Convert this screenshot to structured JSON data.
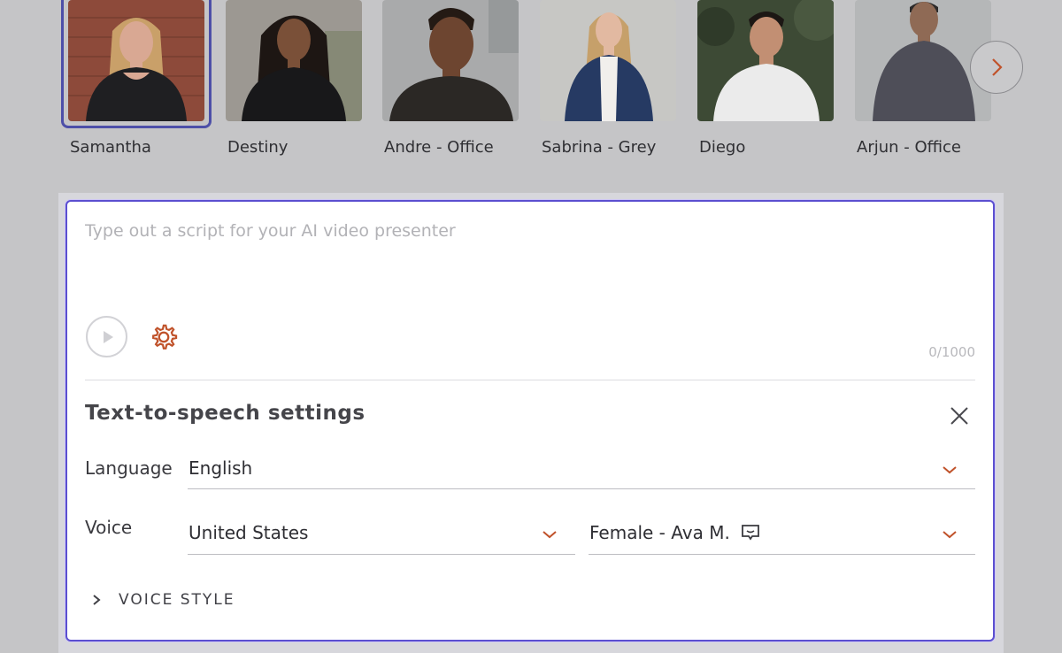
{
  "presenters": [
    {
      "name": "Samantha",
      "selected": true,
      "colors": {
        "bg": "#8d4a3a",
        "hair": "#c9a069",
        "skin": "#d9a893",
        "top": "#1f1f22"
      }
    },
    {
      "name": "Destiny",
      "selected": false,
      "colors": {
        "bg": "#9c9892",
        "hair": "#1d1613",
        "skin": "#7a5038",
        "top": "#18181a"
      }
    },
    {
      "name": "Andre - Office",
      "selected": false,
      "colors": {
        "bg": "#a9aaab",
        "hair": "#241a14",
        "skin": "#6d4530",
        "top": "#2b2825"
      }
    },
    {
      "name": "Sabrina - Grey",
      "selected": false,
      "colors": {
        "bg": "#c7c7c4",
        "hair": "#c6a06a",
        "skin": "#e2b9a1",
        "top": "#263a63"
      }
    },
    {
      "name": "Diego",
      "selected": false,
      "colors": {
        "bg": "#3d4a35",
        "hair": "#1c1714",
        "skin": "#c28f73",
        "top": "#ebebeb"
      }
    },
    {
      "name": "Arjun - Office",
      "selected": false,
      "colors": {
        "bg": "#b5b7b8",
        "hair": "#2b2a2a",
        "skin": "#8f6a55",
        "top": "#4e4e58"
      }
    }
  ],
  "script": {
    "placeholder": "Type out a script for your AI video presenter",
    "value": "",
    "char_count": "0/1000"
  },
  "tts": {
    "title": "Text-to-speech settings",
    "language_label": "Language",
    "language_value": "English",
    "voice_label": "Voice",
    "voice_region": "United States",
    "voice_name": "Female - Ava M.",
    "voice_style_label": "VOICE STYLE"
  },
  "icons": {
    "next": "chevron-right-icon",
    "play": "play-icon",
    "settings": "gear-icon",
    "close": "close-icon",
    "dropdown": "chevron-down-icon",
    "voice_preview": "speech-bubble-icon",
    "expand": "chevron-right-icon"
  },
  "colors": {
    "accent": "#c0522a",
    "selection": "#4d4fa8",
    "panel_border": "#5b4fd0",
    "muted": "#b8b8bc"
  }
}
